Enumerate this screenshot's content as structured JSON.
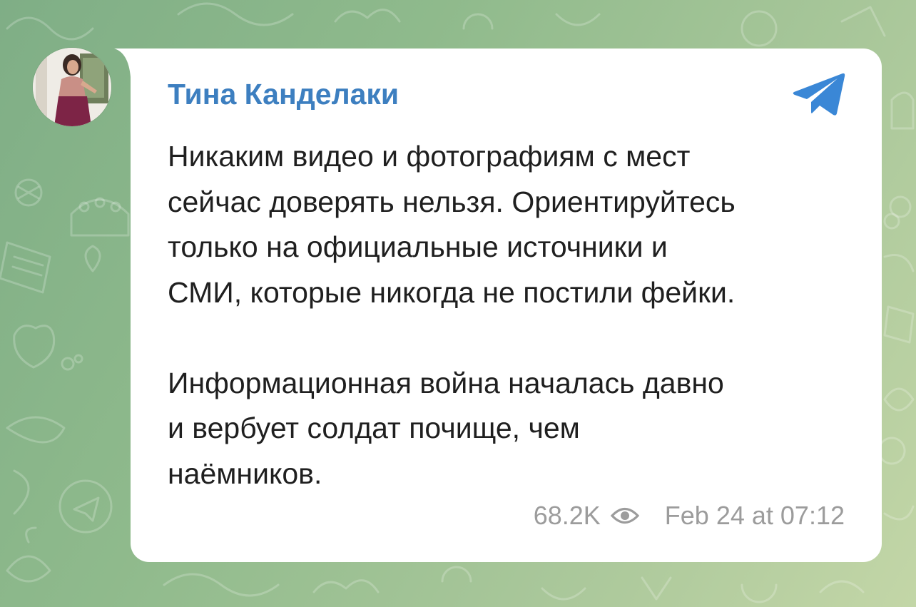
{
  "channel": {
    "author_name": "Тина Канделаки",
    "avatar_icon": "profile-photo",
    "source_icon": "telegram-plane-icon"
  },
  "message": {
    "paragraph_1": "Никаким видео и фотографиям с мест\nсейчас доверять нельзя. Ориентируйтесь\nтолько на официальные источники и\nСМИ, которые никогда не постили фейки.",
    "paragraph_2": "Информационная война началась давно\nи вербует солдат почище, чем\nнаёмников.",
    "views": "68.2K",
    "views_icon": "eye-icon",
    "timestamp": "Feb 24 at 07:12"
  },
  "colors": {
    "author": "#3d7fc0",
    "telegram_blue": "#3a87d6",
    "meta_text": "#9c9c9c",
    "chat_background": "#8fba8c",
    "bubble": "#ffffff"
  }
}
